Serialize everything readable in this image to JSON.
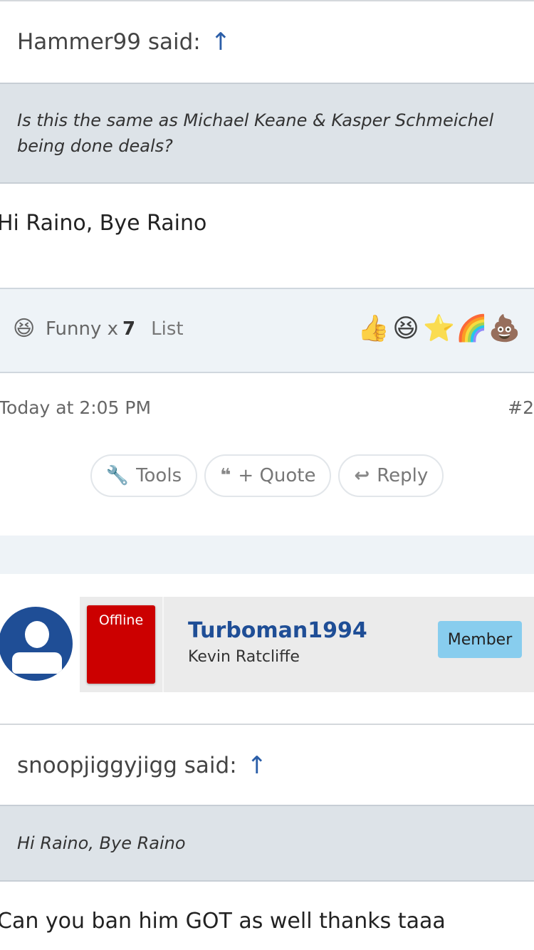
{
  "quote1": {
    "author": "Hammer99 said:",
    "arrow": "↑",
    "text": "Is this the same as Michael Keane & Kasper Schmeichel being done deals?"
  },
  "post1": {
    "message": "Hi Raino, Bye Raino",
    "reactions": {
      "label": "Funny x",
      "count": "7",
      "list_link": "List",
      "summary_icon": "laughing-face-icon",
      "available": [
        "thumbs-up-icon",
        "laughing-face-icon",
        "star-icon",
        "rainbow-icon",
        "poop-icon"
      ]
    },
    "timestamp": "Today at 2:05 PM",
    "post_number": "#2",
    "actions": {
      "tools": "Tools",
      "quote": "+ Quote",
      "reply": "Reply"
    }
  },
  "user": {
    "status": "Offline",
    "username": "Turboman1994",
    "real_name": "Kevin Ratcliffe",
    "role": "Member",
    "status_color": "#cc0000",
    "accent": "#1f4e96",
    "badge_color": "#88cdee"
  },
  "quote2": {
    "author": "snoopjiggyjigg said:",
    "arrow": "↑",
    "text": "Hi Raino, Bye Raino"
  },
  "post2": {
    "message": "Can you ban him GOT as well thanks taaa"
  }
}
